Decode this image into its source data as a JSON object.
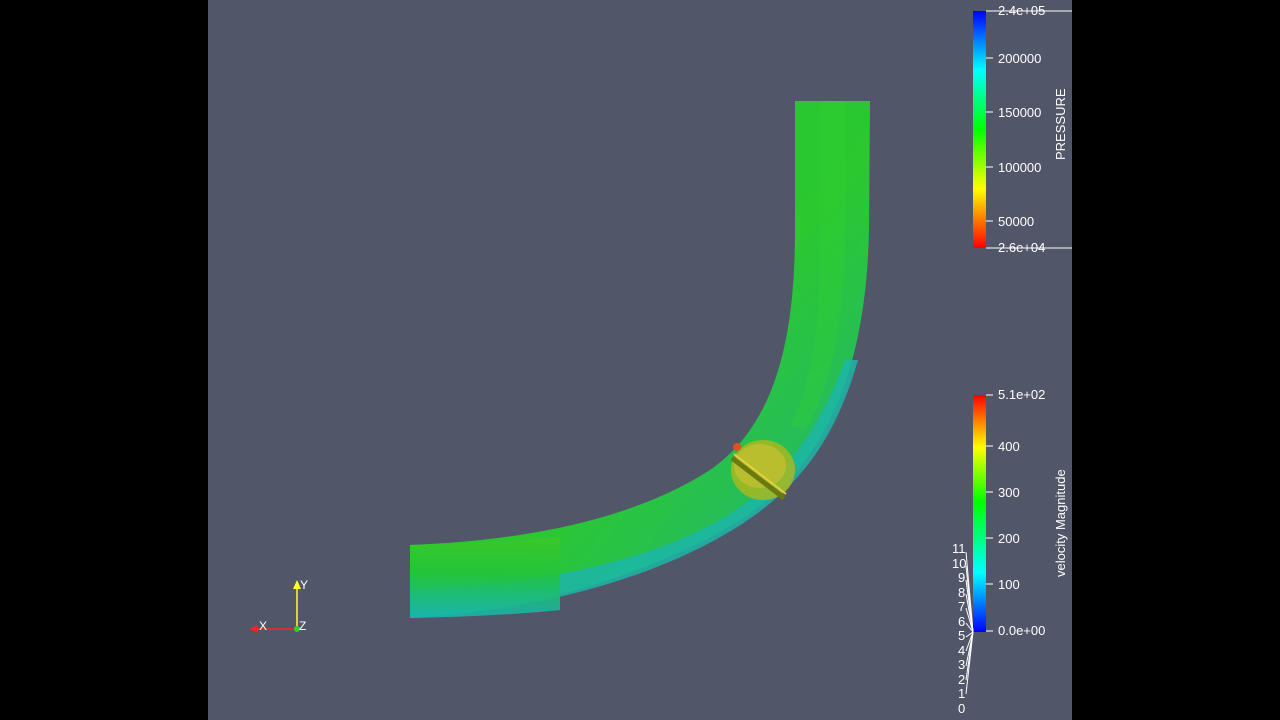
{
  "viewport": {
    "background": "#525669",
    "letterbox": "#000000"
  },
  "pressure_legend": {
    "title": "PRESSURE",
    "max_label": "2.4e+05",
    "min_label": "2.6e+04",
    "ticks": [
      "200000",
      "150000",
      "100000",
      "50000"
    ],
    "colormap": [
      "#0000ff",
      "#00ffff",
      "#00ff00",
      "#ffff00",
      "#ff0000"
    ]
  },
  "velocity_legend": {
    "title": "velocity Magnitude",
    "max_label": "5.1e+02",
    "min_label": "0.0e+00",
    "ticks": [
      "400",
      "300",
      "200",
      "100"
    ],
    "colormap": [
      "#ff0000",
      "#ffff00",
      "#00ff00",
      "#00ffff",
      "#0000ff"
    ]
  },
  "index_labels": [
    "11",
    "10",
    "9",
    "8",
    "7",
    "6",
    "5",
    "4",
    "3",
    "2",
    "1",
    "0"
  ],
  "orientation_axes": {
    "x_label": "X",
    "y_label": "Y",
    "z_label": "Z",
    "x_color": "#ff2020",
    "y_color": "#ffff30",
    "z_color": "#30d030"
  },
  "pipe": {
    "fill_color": "#22c832",
    "inner_wall_color": "#1ab4a8",
    "valve_color": "#c0c020"
  }
}
